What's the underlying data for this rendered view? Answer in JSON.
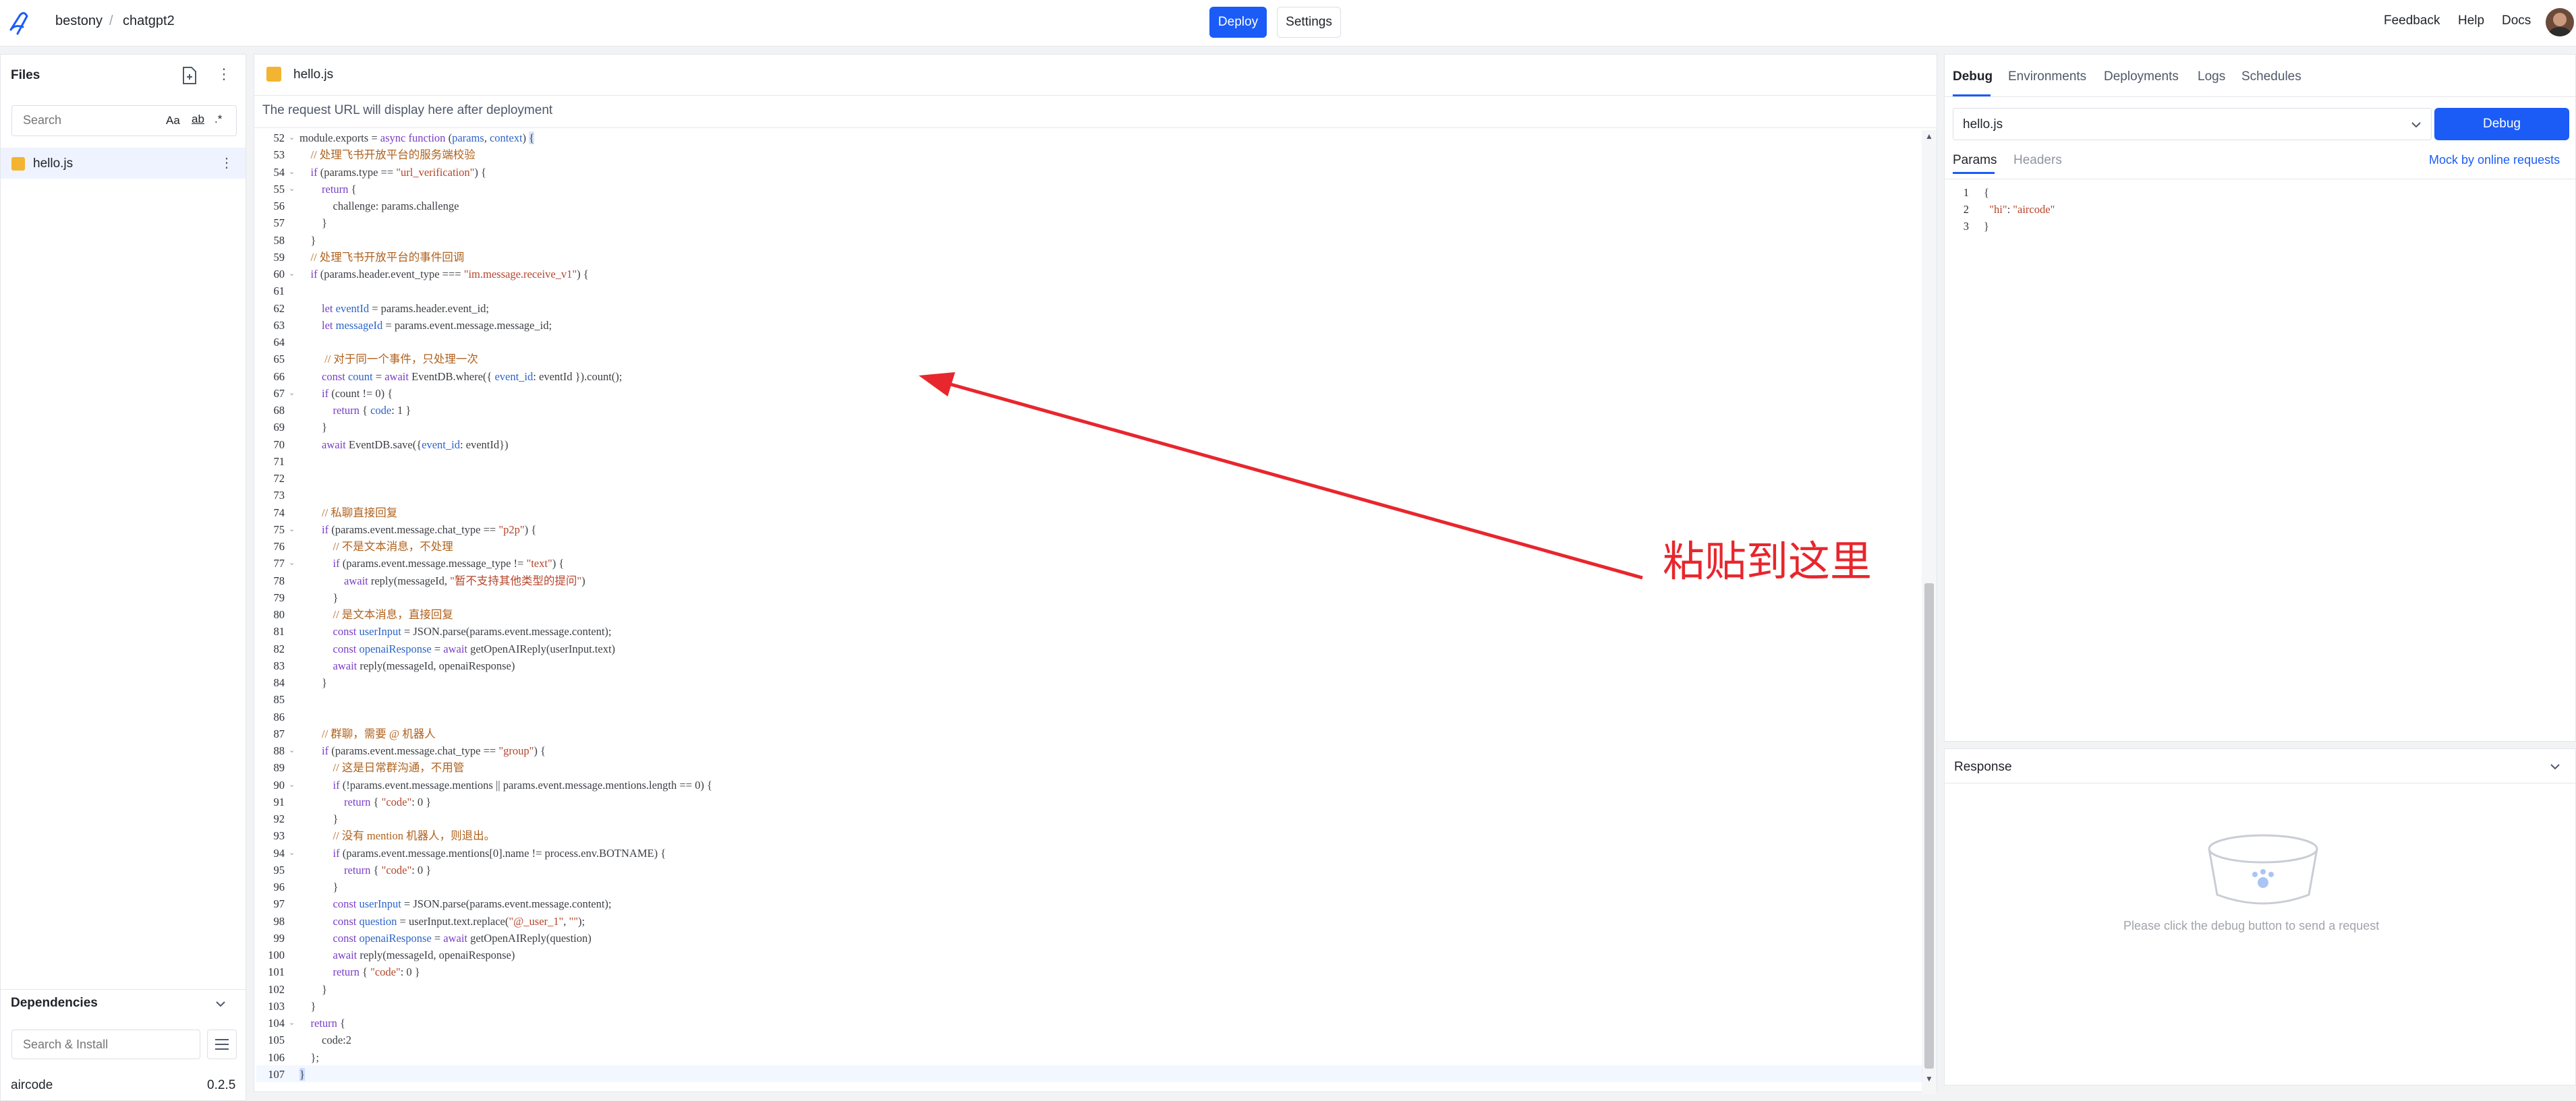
{
  "topbar": {
    "breadcrumb": [
      "bestony",
      "chatgpt2"
    ],
    "deploy_label": "Deploy",
    "settings_label": "Settings",
    "links": [
      "Feedback",
      "Help",
      "Docs"
    ]
  },
  "files": {
    "title": "Files",
    "search_placeholder": "Search",
    "search_option_case": "Aa",
    "items": [
      {
        "name": "hello.js"
      }
    ]
  },
  "dependencies": {
    "title": "Dependencies",
    "search_placeholder": "Search & Install",
    "items": [
      {
        "name": "aircode",
        "version": "0.2.5"
      }
    ]
  },
  "editor": {
    "tab_label": "hello.js",
    "url_hint": "The request URL will display here after deployment",
    "lines": [
      {
        "n": "52",
        "fold": true,
        "html": "module.exports = <span class=\"kw\">async function</span> (<span class=\"vr\">params</span>, <span class=\"vr\">context</span>) <span style=\"background:#d9e4ff\">{</span>"
      },
      {
        "n": "53",
        "html": "    <span class=\"cm\">// 处理飞书开放平台的服务端校验</span>"
      },
      {
        "n": "54",
        "fold": true,
        "html": "    <span class=\"kw\">if</span> (params.type == <span class=\"st\">\"url_verification\"</span>) {"
      },
      {
        "n": "55",
        "fold": true,
        "html": "        <span class=\"kw\">return</span> {"
      },
      {
        "n": "56",
        "html": "            challenge: params.challenge"
      },
      {
        "n": "57",
        "html": "        }"
      },
      {
        "n": "58",
        "html": "    }"
      },
      {
        "n": "59",
        "html": "    <span class=\"cm\">// 处理飞书开放平台的事件回调</span>"
      },
      {
        "n": "60",
        "fold": true,
        "html": "    <span class=\"kw\">if</span> (params.header.event_type === <span class=\"st\">\"im.message.receive_v1\"</span>) {"
      },
      {
        "n": "61",
        "html": ""
      },
      {
        "n": "62",
        "html": "        <span class=\"kw\">let</span> <span class=\"vr\">eventId</span> = params.header.event_id;"
      },
      {
        "n": "63",
        "html": "        <span class=\"kw\">let</span> <span class=\"vr\">messageId</span> = params.event.message.message_id;"
      },
      {
        "n": "64",
        "html": ""
      },
      {
        "n": "65",
        "html": "         <span class=\"cm\">// 对于同一个事件，只处理一次</span>"
      },
      {
        "n": "66",
        "html": "        <span class=\"kw\">const</span> <span class=\"vr\">count</span> = <span class=\"kw\">await</span> EventDB.where({ <span class=\"vr\">event_id</span>: eventId }).count();"
      },
      {
        "n": "67",
        "fold": true,
        "html": "        <span class=\"kw\">if</span> (count != 0) {"
      },
      {
        "n": "68",
        "html": "            <span class=\"kw\">return</span> { <span class=\"vr\">code</span>: 1 }"
      },
      {
        "n": "69",
        "html": "        }"
      },
      {
        "n": "70",
        "html": "        <span class=\"kw\">await</span> EventDB.save({<span class=\"vr\">event_id</span>: eventId})"
      },
      {
        "n": "71",
        "html": ""
      },
      {
        "n": "72",
        "html": ""
      },
      {
        "n": "73",
        "html": ""
      },
      {
        "n": "74",
        "html": "        <span class=\"cm\">// 私聊直接回复</span>"
      },
      {
        "n": "75",
        "fold": true,
        "html": "        <span class=\"kw\">if</span> (params.event.message.chat_type == <span class=\"st\">\"p2p\"</span>) {"
      },
      {
        "n": "76",
        "html": "            <span class=\"cm\">// 不是文本消息，不处理</span>"
      },
      {
        "n": "77",
        "fold": true,
        "html": "            <span class=\"kw\">if</span> (params.event.message.message_type != <span class=\"st\">\"text\"</span>) {"
      },
      {
        "n": "78",
        "html": "                <span class=\"kw\">await</span> reply(messageId, <span class=\"st\">\"暂不支持其他类型的提问\"</span>)"
      },
      {
        "n": "79",
        "html": "            }"
      },
      {
        "n": "80",
        "html": "            <span class=\"cm\">// 是文本消息，直接回复</span>"
      },
      {
        "n": "81",
        "html": "            <span class=\"kw\">const</span> <span class=\"vr\">userInput</span> = JSON.parse(params.event.message.content);"
      },
      {
        "n": "82",
        "html": "            <span class=\"kw\">const</span> <span class=\"vr\">openaiResponse</span> = <span class=\"kw\">await</span> getOpenAIReply(userInput.text)"
      },
      {
        "n": "83",
        "html": "            <span class=\"kw\">await</span> reply(messageId, openaiResponse)"
      },
      {
        "n": "84",
        "html": "        }"
      },
      {
        "n": "85",
        "html": ""
      },
      {
        "n": "86",
        "html": ""
      },
      {
        "n": "87",
        "html": "        <span class=\"cm\">// 群聊，需要 @ 机器人</span>"
      },
      {
        "n": "88",
        "fold": true,
        "html": "        <span class=\"kw\">if</span> (params.event.message.chat_type == <span class=\"st\">\"group\"</span>) {"
      },
      {
        "n": "89",
        "html": "            <span class=\"cm\">// 这是日常群沟通，不用管</span>"
      },
      {
        "n": "90",
        "fold": true,
        "html": "            <span class=\"kw\">if</span> (!params.event.message.mentions || params.event.message.mentions.length == 0) {"
      },
      {
        "n": "91",
        "html": "                <span class=\"kw\">return</span> { <span class=\"st\">\"code\"</span>: 0 }"
      },
      {
        "n": "92",
        "html": "            }"
      },
      {
        "n": "93",
        "html": "            <span class=\"cm\">// 没有 mention 机器人，则退出。</span>"
      },
      {
        "n": "94",
        "fold": true,
        "html": "            <span class=\"kw\">if</span> (params.event.message.mentions[0].name != process.env.BOTNAME) {"
      },
      {
        "n": "95",
        "html": "                <span class=\"kw\">return</span> { <span class=\"st\">\"code\"</span>: 0 }"
      },
      {
        "n": "96",
        "html": "            }"
      },
      {
        "n": "97",
        "html": "            <span class=\"kw\">const</span> <span class=\"vr\">userInput</span> = JSON.parse(params.event.message.content);"
      },
      {
        "n": "98",
        "html": "            <span class=\"kw\">const</span> <span class=\"vr\">question</span> = userInput.text.replace(<span class=\"st\">\"@_user_1\"</span>, <span class=\"st\">\"\"</span>);"
      },
      {
        "n": "99",
        "html": "            <span class=\"kw\">const</span> <span class=\"vr\">openaiResponse</span> = <span class=\"kw\">await</span> getOpenAIReply(question)"
      },
      {
        "n": "100",
        "html": "            <span class=\"kw\">await</span> reply(messageId, openaiResponse)"
      },
      {
        "n": "101",
        "html": "            <span class=\"kw\">return</span> { <span class=\"st\">\"code\"</span>: 0 }"
      },
      {
        "n": "102",
        "html": "        }"
      },
      {
        "n": "103",
        "html": "    }"
      },
      {
        "n": "104",
        "fold": true,
        "html": "    <span class=\"kw\">return</span> {"
      },
      {
        "n": "105",
        "html": "        code:2"
      },
      {
        "n": "106",
        "html": "    };"
      },
      {
        "n": "107",
        "html": "<span style=\"background:#d9e4ff\">}</span>"
      }
    ]
  },
  "annotation": {
    "text": "粘贴到这里",
    "color": "#e8262d"
  },
  "right": {
    "tabs": [
      "Debug",
      "Environments",
      "Deployments",
      "Logs",
      "Schedules"
    ],
    "active_tab": "Debug",
    "file_select": "hello.js",
    "debug_button": "Debug",
    "subtabs": [
      "Params",
      "Headers"
    ],
    "mock_link": "Mock by online requests",
    "json_lines": [
      {
        "n": "1",
        "html": "{"
      },
      {
        "n": "2",
        "html": "  <span class=\"st\">\"hi\"</span>: <span class=\"st\">\"aircode\"</span>"
      },
      {
        "n": "3",
        "html": "}"
      }
    ],
    "response_title": "Response",
    "response_empty": "Please click the debug button to send a request"
  },
  "colors": {
    "accent": "#1b5cf7"
  }
}
